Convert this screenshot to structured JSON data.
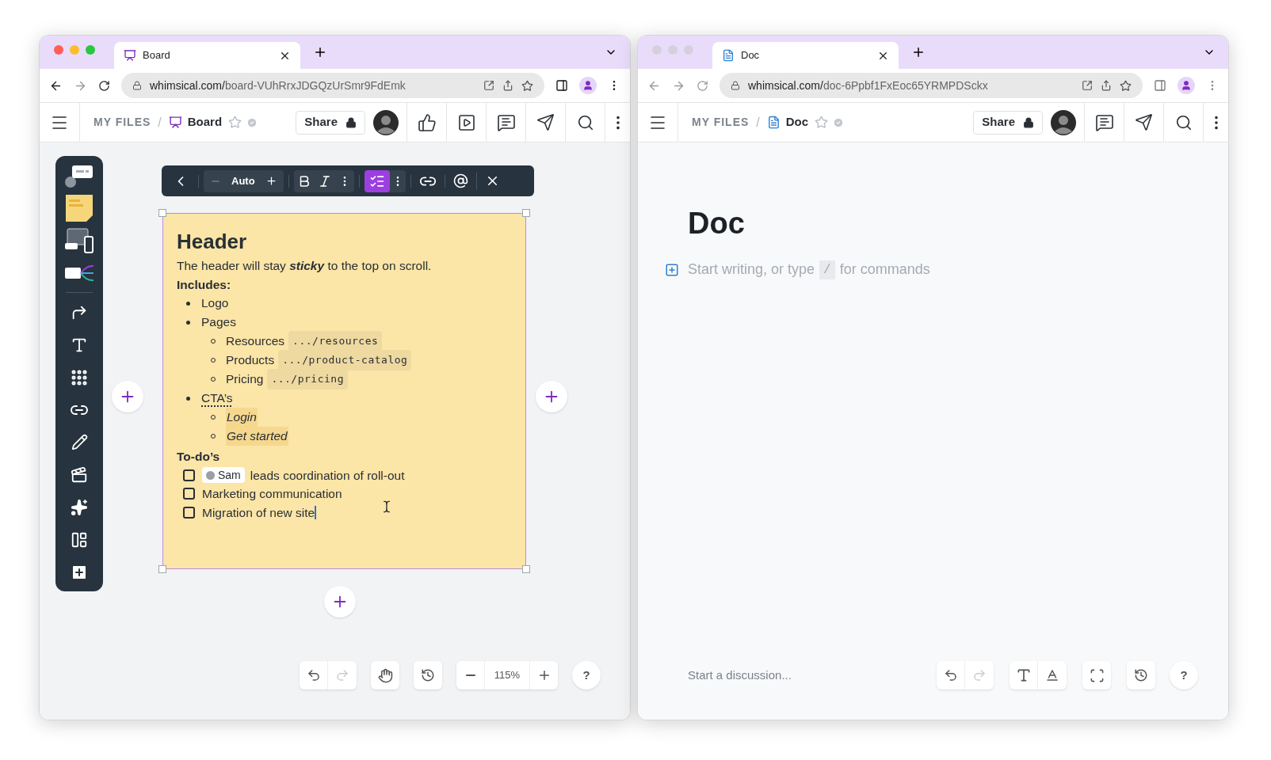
{
  "board_window": {
    "kind": "board",
    "focused": true,
    "tab": {
      "title": "Board"
    },
    "url": {
      "host": "whimsical.com/",
      "path": "board-VUhRrxJDGQzUrSmr9FdEmk"
    },
    "header": {
      "breadcrumb": "MY FILES",
      "separator": "/",
      "title": "Board",
      "share": "Share"
    },
    "format_toolbar": {
      "size": "Auto",
      "checklist_active": true
    },
    "card": {
      "title": "Header",
      "intro": "The header will stay *sticky* to the top on scroll.",
      "includes_label": "Includes:",
      "list": [
        {
          "kind": "text",
          "text": "Logo"
        },
        {
          "kind": "text",
          "text": "Pages",
          "children": [
            {
              "kind": "code",
              "text": "Resources",
              "code": ".../resources"
            },
            {
              "kind": "code",
              "text": "Products",
              "code": ".../product-catalog"
            },
            {
              "kind": "code",
              "text": "Pricing",
              "code": ".../pricing"
            }
          ]
        },
        {
          "kind": "underlined",
          "text": "CTA’s",
          "children": [
            {
              "kind": "highlight",
              "text": "Login"
            },
            {
              "kind": "highlight",
              "text": "Get started"
            }
          ]
        }
      ],
      "todo_label": "To-do’s",
      "todos": [
        {
          "mention": "Sam",
          "text": "leads coordination of roll-out",
          "checked": false
        },
        {
          "text": "Marketing communication",
          "checked": false
        },
        {
          "text": "Migration of new site",
          "checked": false
        }
      ]
    },
    "bottom_bar": {
      "undo": {
        "disabled": false
      },
      "redo": {
        "disabled": true
      },
      "zoom": "115%",
      "help": "?"
    }
  },
  "doc_window": {
    "kind": "doc",
    "focused": false,
    "tab": {
      "title": "Doc"
    },
    "url": {
      "host": "whimsical.com/",
      "path": "doc-6Ppbf1FxEoc65YRMPDSckx"
    },
    "header": {
      "breadcrumb": "MY FILES",
      "separator": "/",
      "title": "Doc",
      "share": "Share"
    },
    "doc": {
      "title": "Doc",
      "placeholder_before": "Start writing, or type",
      "placeholder_key": "/",
      "placeholder_after": "for commands"
    },
    "bottom_bar": {
      "discussion_placeholder": "Start a discussion...",
      "undo": {
        "disabled": false
      },
      "redo": {
        "disabled": true
      },
      "help": "?"
    }
  }
}
